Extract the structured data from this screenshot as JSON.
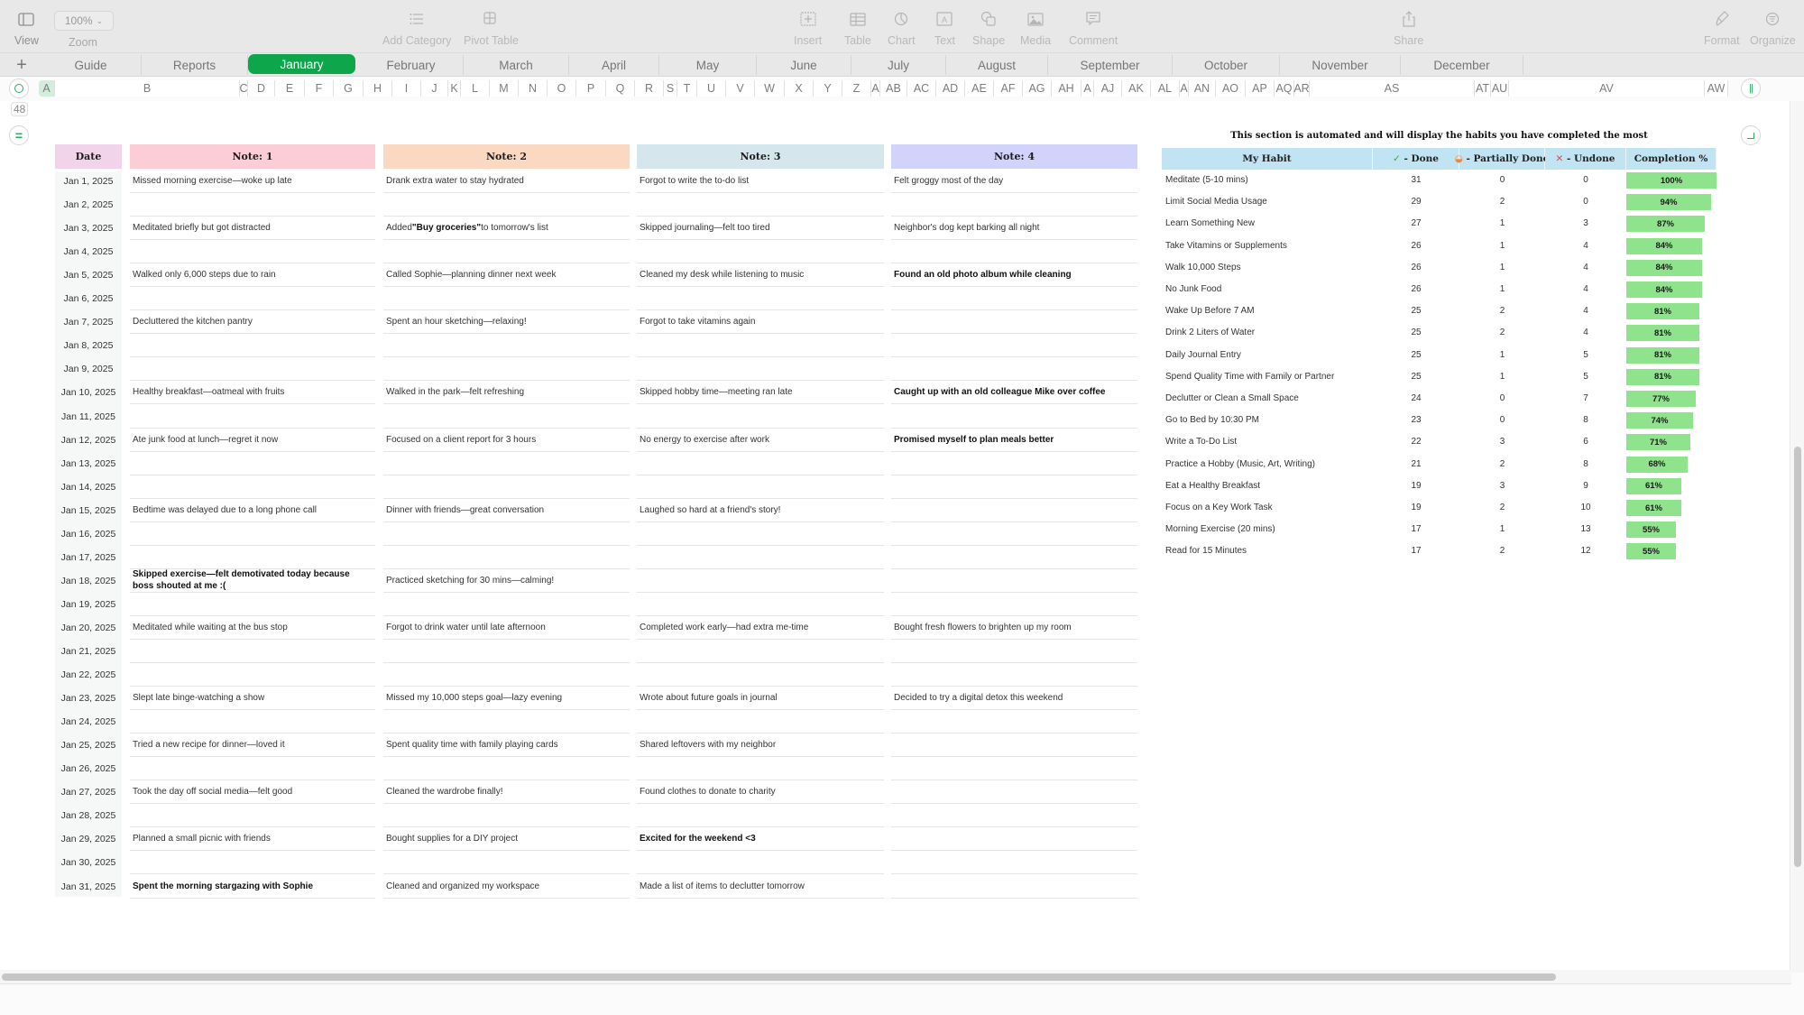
{
  "toolbar": {
    "view_label": "View",
    "zoom_value": "100%",
    "zoom_label": "Zoom",
    "add_category_label": "Add Category",
    "pivot_table_label": "Pivot Table",
    "insert_label": "Insert",
    "table_label": "Table",
    "chart_label": "Chart",
    "text_label": "Text",
    "shape_label": "Shape",
    "media_label": "Media",
    "comment_label": "Comment",
    "share_label": "Share",
    "format_label": "Format",
    "organize_label": "Organize"
  },
  "sheet_tabs": {
    "add_label": "+",
    "tabs": [
      {
        "label": "Guide"
      },
      {
        "label": "Reports"
      },
      {
        "label": "January",
        "active": true
      },
      {
        "label": "February"
      },
      {
        "label": "March"
      },
      {
        "label": "April"
      },
      {
        "label": "May"
      },
      {
        "label": "June"
      },
      {
        "label": "July"
      },
      {
        "label": "August"
      },
      {
        "label": "September"
      },
      {
        "label": "October"
      },
      {
        "label": "November"
      },
      {
        "label": "December"
      }
    ],
    "active_color": "#0ea64a"
  },
  "column_headers": [
    "A",
    "B",
    "C",
    "D",
    "E",
    "F",
    "G",
    "H",
    "I",
    "J",
    "K",
    "L",
    "M",
    "N",
    "O",
    "P",
    "Q",
    "R",
    "S",
    "T",
    "U",
    "V",
    "W",
    "X",
    "Y",
    "Z",
    "AA",
    "AB",
    "AC",
    "AD",
    "AE",
    "AF",
    "AG",
    "AH",
    "AI",
    "AJ",
    "AK",
    "AL",
    "AM",
    "AN",
    "AO",
    "AP",
    "AQ",
    "AR",
    "AS",
    "AT",
    "AU",
    "AV",
    "AW"
  ],
  "row_indicator": "48",
  "notes_table": {
    "headers": {
      "date": "Date",
      "note1": "Note: 1",
      "note2": "Note: 2",
      "note3": "Note: 3",
      "note4": "Note: 4"
    },
    "header_colors": {
      "date": "#f1d4ea",
      "note1": "#fccdd6",
      "note2": "#fbd8c2",
      "note3": "#d5e7ec",
      "note4": "#d2d3fb"
    },
    "rows": [
      {
        "date": "Jan 1, 2025",
        "n1": "Missed morning exercise—woke up late",
        "n2": "Drank extra water to stay hydrated",
        "n3": "Forgot to write the to-do list",
        "n4": "Felt groggy most of the day"
      },
      {
        "date": "Jan 2, 2025",
        "n1": "",
        "n2": "",
        "n3": "",
        "n4": ""
      },
      {
        "date": "Jan 3, 2025",
        "n1": "Meditated briefly but got distracted",
        "n2_pre": "Added ",
        "n2_bold": "\"Buy groceries\"",
        "n2_post": " to tomorrow's list",
        "n3": "Skipped journaling—felt too tired",
        "n4": "Neighbor's dog kept barking all night"
      },
      {
        "date": "Jan 4, 2025",
        "n1": "",
        "n2": "",
        "n3": "",
        "n4": ""
      },
      {
        "date": "Jan 5, 2025",
        "n1": "Walked only 6,000 steps due to rain",
        "n2": "Called Sophie—planning dinner next week",
        "n3": "Cleaned my desk while listening to music",
        "n4": "Found an old photo album while cleaning",
        "n4_bold": true
      },
      {
        "date": "Jan 6, 2025",
        "n1": "",
        "n2": "",
        "n3": "",
        "n4": ""
      },
      {
        "date": "Jan 7, 2025",
        "n1": "Decluttered the kitchen pantry",
        "n2": "Spent an hour sketching—relaxing!",
        "n3": "Forgot to take vitamins again",
        "n4": ""
      },
      {
        "date": "Jan 8, 2025",
        "n1": "",
        "n2": "",
        "n3": "",
        "n4": ""
      },
      {
        "date": "Jan 9, 2025",
        "n1": "",
        "n2": "",
        "n3": "",
        "n4": ""
      },
      {
        "date": "Jan 10, 2025",
        "n1": "Healthy breakfast—oatmeal with fruits",
        "n2": "Walked in the park—felt refreshing",
        "n3": "Skipped hobby time—meeting ran late",
        "n4": "Caught up with an old colleague Mike over coffee",
        "n4_bold": true
      },
      {
        "date": "Jan 11, 2025",
        "n1": "",
        "n2": "",
        "n3": "",
        "n4": ""
      },
      {
        "date": "Jan 12, 2025",
        "n1": "Ate junk food at lunch—regret it now",
        "n2": "Focused on a client report for 3 hours",
        "n3": "No energy to exercise after work",
        "n4": "Promised myself to plan meals better",
        "n4_bold": true
      },
      {
        "date": "Jan 13, 2025",
        "n1": "",
        "n2": "",
        "n3": "",
        "n4": ""
      },
      {
        "date": "Jan 14, 2025",
        "n1": "",
        "n2": "",
        "n3": "",
        "n4": ""
      },
      {
        "date": "Jan 15, 2025",
        "n1": "Bedtime was delayed due to a long phone call",
        "n2": "Dinner with friends—great conversation",
        "n3": "Laughed so hard at a friend's story!",
        "n4": ""
      },
      {
        "date": "Jan 16, 2025",
        "n1": "",
        "n2": "",
        "n3": "",
        "n4": ""
      },
      {
        "date": "Jan 17, 2025",
        "n1": "",
        "n2": "",
        "n3": "",
        "n4": ""
      },
      {
        "date": "Jan 18, 2025",
        "n1": "Skipped exercise—felt demotivated today because boss shouted at me :(",
        "n1_bold": true,
        "n2": "Practiced sketching for 30 mins—calming!",
        "n3": "",
        "n4": ""
      },
      {
        "date": "Jan 19, 2025",
        "n1": "",
        "n2": "",
        "n3": "",
        "n4": ""
      },
      {
        "date": "Jan 20, 2025",
        "n1": "Meditated while waiting at the bus stop",
        "n2": "Forgot to drink water until late afternoon",
        "n3": "Completed work early—had extra me-time",
        "n4": "Bought fresh flowers to brighten up my room"
      },
      {
        "date": "Jan 21, 2025",
        "n1": "",
        "n2": "",
        "n3": "",
        "n4": ""
      },
      {
        "date": "Jan 22, 2025",
        "n1": "",
        "n2": "",
        "n3": "",
        "n4": ""
      },
      {
        "date": "Jan 23, 2025",
        "n1": "Slept late binge-watching a show",
        "n2": "Missed my 10,000 steps goal—lazy evening",
        "n3": "Wrote about future goals in journal",
        "n4": "Decided to try a digital detox this weekend"
      },
      {
        "date": "Jan 24, 2025",
        "n1": "",
        "n2": "",
        "n3": "",
        "n4": ""
      },
      {
        "date": "Jan 25, 2025",
        "n1": "Tried a new recipe for dinner—loved it",
        "n2": "Spent quality time with family playing cards",
        "n3": "Shared leftovers with my neighbor",
        "n4": ""
      },
      {
        "date": "Jan 26, 2025",
        "n1": "",
        "n2": "",
        "n3": "",
        "n4": ""
      },
      {
        "date": "Jan 27, 2025",
        "n1": "Took the day off social media—felt good",
        "n2": "Cleaned the wardrobe finally!",
        "n3": "Found clothes to donate to charity",
        "n4": ""
      },
      {
        "date": "Jan 28, 2025",
        "n1": "",
        "n2": "",
        "n3": "",
        "n4": ""
      },
      {
        "date": "Jan 29, 2025",
        "n1": "Planned a small picnic with friends",
        "n2": "Bought supplies for a DIY project",
        "n3": "Excited for the weekend <3",
        "n3_bold": true,
        "n4": ""
      },
      {
        "date": "Jan 30, 2025",
        "n1": "",
        "n2": "",
        "n3": "",
        "n4": ""
      },
      {
        "date": "Jan 31, 2025",
        "n1": "Spent the morning stargazing with Sophie",
        "n1_bold": true,
        "n2": "Cleaned and organized my workspace",
        "n3": "Made a list of items to declutter tomorrow",
        "n4": ""
      }
    ]
  },
  "summary": {
    "title": "This section is automated and will display the habits you have completed the most",
    "headers": {
      "habit": "My Habit",
      "done_icon": "✓",
      "done": " - Done",
      "partial_icon": "◒",
      "partial": " - Partially Done",
      "undone_icon": "✕",
      "undone": " - Undone",
      "completion": "Completion %"
    },
    "header_color": "#c0e4f2",
    "bar_color": "#90e38d",
    "rows": [
      {
        "habit": "Meditate (5-10 mins)",
        "done": 31,
        "partial": 0,
        "undone": 0,
        "pct": 100,
        "pct_label": "100%"
      },
      {
        "habit": "Limit Social Media Usage",
        "done": 29,
        "partial": 2,
        "undone": 0,
        "pct": 94,
        "pct_label": "94%"
      },
      {
        "habit": "Learn Something New",
        "done": 27,
        "partial": 1,
        "undone": 3,
        "pct": 87,
        "pct_label": "87%"
      },
      {
        "habit": "Take Vitamins or Supplements",
        "done": 26,
        "partial": 1,
        "undone": 4,
        "pct": 84,
        "pct_label": "84%"
      },
      {
        "habit": "Walk 10,000 Steps",
        "done": 26,
        "partial": 1,
        "undone": 4,
        "pct": 84,
        "pct_label": "84%"
      },
      {
        "habit": "No Junk Food",
        "done": 26,
        "partial": 1,
        "undone": 4,
        "pct": 84,
        "pct_label": "84%"
      },
      {
        "habit": "Wake Up Before 7 AM",
        "done": 25,
        "partial": 2,
        "undone": 4,
        "pct": 81,
        "pct_label": "81%"
      },
      {
        "habit": "Drink 2 Liters of Water",
        "done": 25,
        "partial": 2,
        "undone": 4,
        "pct": 81,
        "pct_label": "81%"
      },
      {
        "habit": "Daily Journal Entry",
        "done": 25,
        "partial": 1,
        "undone": 5,
        "pct": 81,
        "pct_label": "81%"
      },
      {
        "habit": "Spend Quality Time with Family or Partner",
        "done": 25,
        "partial": 1,
        "undone": 5,
        "pct": 81,
        "pct_label": "81%"
      },
      {
        "habit": "Declutter or Clean a Small Space",
        "done": 24,
        "partial": 0,
        "undone": 7,
        "pct": 77,
        "pct_label": "77%"
      },
      {
        "habit": "Go to Bed by 10:30 PM",
        "done": 23,
        "partial": 0,
        "undone": 8,
        "pct": 74,
        "pct_label": "74%"
      },
      {
        "habit": "Write a To-Do List",
        "done": 22,
        "partial": 3,
        "undone": 6,
        "pct": 71,
        "pct_label": "71%"
      },
      {
        "habit": "Practice a Hobby (Music, Art, Writing)",
        "done": 21,
        "partial": 2,
        "undone": 8,
        "pct": 68,
        "pct_label": "68%"
      },
      {
        "habit": "Eat a Healthy Breakfast",
        "done": 19,
        "partial": 3,
        "undone": 9,
        "pct": 61,
        "pct_label": "61%"
      },
      {
        "habit": "Focus on a Key Work Task",
        "done": 19,
        "partial": 2,
        "undone": 10,
        "pct": 61,
        "pct_label": "61%"
      },
      {
        "habit": "Morning Exercise (20 mins)",
        "done": 17,
        "partial": 1,
        "undone": 13,
        "pct": 55,
        "pct_label": "55%"
      },
      {
        "habit": "Read for 15 Minutes",
        "done": 17,
        "partial": 2,
        "undone": 12,
        "pct": 55,
        "pct_label": "55%"
      }
    ]
  }
}
